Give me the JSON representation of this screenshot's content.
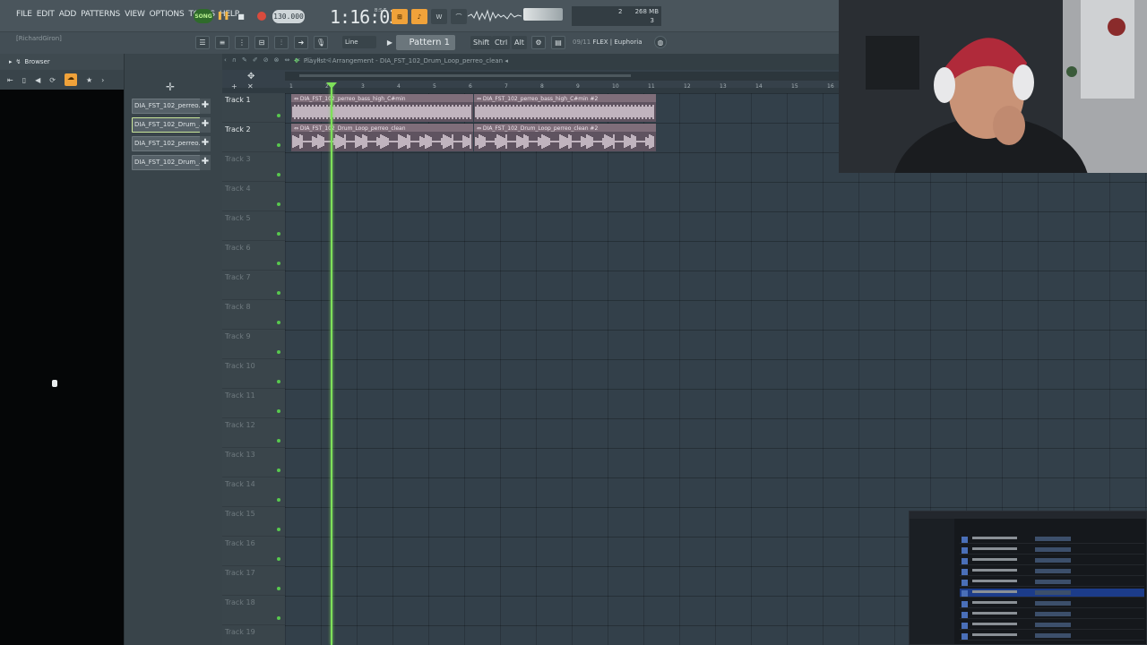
{
  "menu": [
    "FILE",
    "EDIT",
    "ADD",
    "PATTERNS",
    "VIEW",
    "OPTIONS",
    "TOOLS",
    "HELP"
  ],
  "transport": {
    "song_label": "SONG",
    "tempo": "130.000",
    "time": "1:16:03",
    "time_sub": "B:S:T"
  },
  "cpu": {
    "voices": "2",
    "memory": "268 MB",
    "cores": "3"
  },
  "toolbar2": {
    "user": "[RichardGiron]",
    "snap": "Line",
    "pattern": "Pattern 1",
    "shift": "Shift",
    "ctrl": "Ctrl",
    "alt": "Alt",
    "hint_num": "09/11",
    "hint": "FLEX | Euphoria"
  },
  "browser": {
    "title": "Browser"
  },
  "picker": {
    "items": [
      "DIA_FST_102_perreo...",
      "DIA_FST_102_Drum_...",
      "DIA_FST_102_perreo...",
      "DIA_FST_102_Drum_..."
    ]
  },
  "playlist": {
    "title": "Playlist - Arrangement",
    "pattern": "DIA_FST_102_Drum_Loop_perreo_clean",
    "ruler": [
      "1",
      "2",
      "3",
      "4",
      "5",
      "6",
      "7",
      "8",
      "9",
      "10",
      "11",
      "12",
      "13",
      "14",
      "15",
      "16"
    ],
    "tracks": [
      "Track 1",
      "Track 2",
      "Track 3",
      "Track 4",
      "Track 5",
      "Track 6",
      "Track 7",
      "Track 8",
      "Track 9",
      "Track 10",
      "Track 11",
      "Track 12",
      "Track 13",
      "Track 14",
      "Track 15",
      "Track 16",
      "Track 17",
      "Track 18",
      "Track 19"
    ],
    "clips": [
      {
        "track": 0,
        "start_bar": 1,
        "end_bar": 6.1,
        "name": "DIA_FST_102_perreo_bass_high_C#min"
      },
      {
        "track": 0,
        "start_bar": 6.1,
        "end_bar": 11.2,
        "name": "DIA_FST_102_perreo_bass_high_C#min #2"
      },
      {
        "track": 1,
        "start_bar": 1,
        "end_bar": 6.1,
        "name": "DIA_FST_102_Drum_Loop_perreo_clean"
      },
      {
        "track": 1,
        "start_bar": 6.1,
        "end_bar": 11.2,
        "name": "DIA_FST_102_Drum_Loop_perreo_clean #2"
      }
    ],
    "playhead_bar": 2.1
  },
  "colors": {
    "clip_header": "#7f6e7a",
    "clip_body": "#5f5360",
    "wave": "#e9dde6",
    "playhead": "#7ee05a",
    "accent": "#f0a23a"
  }
}
